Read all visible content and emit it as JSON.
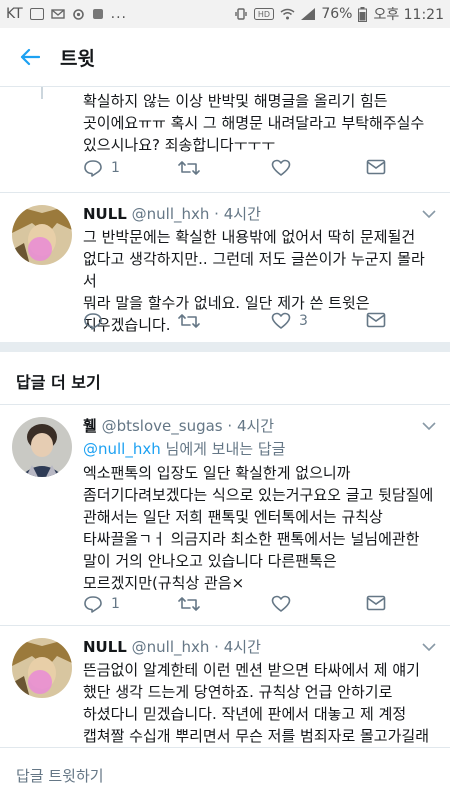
{
  "statusbar": {
    "carrier": "KT",
    "more": "...",
    "battery": "76%",
    "time": "오후 11:21"
  },
  "appbar": {
    "title": "트윗"
  },
  "tweets_top": {
    "text": "확실하지 않는 이상 반박및 해명글을 올리기 힘든\n곳이에요ㅠㅠ 혹시 그 해명문 내려달라고 부탁해주실수\n있으시나요? 죄송합니다ㅜㅜㅜ",
    "reply_count": "1"
  },
  "tweet2": {
    "name": "NULL",
    "handle": "@null_hxh",
    "dot": "·",
    "time": "4시간",
    "text": "그 반박문에는 확실한 내용밖에 없어서 딱히 문제될건\n없다고 생각하지만.. 그런데 저도 글쓴이가 누군지 몰라서\n뭐라 말을 할수가 없네요. 일단 제가 쓴 트윗은\n지우겠습니다.",
    "like_count": "3"
  },
  "more_replies": {
    "title": "답글 더 보기"
  },
  "tweet3": {
    "name": "휄",
    "handle": "@btslove_sugas",
    "dot": "·",
    "time": "4시간",
    "reply_mention": "@null_hxh",
    "reply_suffix": " 님에게 보내는 답글",
    "text": "엑소팬톡의 입장도 일단 확실한게 없으니까\n좀더기다려보겠다는 식으로 있는거구요오 글고 뒷담질에\n관해서는 일단 저희 팬톡및 엔터톡에서는 규칙상\n타싸끌올ㄱㅓ 의금지라 최소한 팬톡에서는 널님에관한\n말이 거의 안나오고 있습니다 다른팬톡은\n모르겠지만(규칙상 관음×",
    "reply_count": "1"
  },
  "tweet4": {
    "name": "NULL",
    "handle": "@null_hxh",
    "dot": "·",
    "time": "4시간",
    "text": "뜬금없이 알계한테 이런 멘션 받으면 타싸에서 제 얘기\n했단 생각 드는게 당연하죠. 규칙상 언급 안하기로\n하셨다니 믿겠습니다. 작년에 판에서 대놓고 제 계정\n캡쳐짤 수십개 뿌리면서 무슨 저를 범죄자로 몰고가길래\n아직도 그러는줄 알았어요ㅋㅋ"
  },
  "reply_input": {
    "placeholder": "답글 트윗하기"
  },
  "colors": {
    "accent": "#1da1f2",
    "muted": "#657786",
    "text": "#14171a",
    "divider": "#e1e8ed"
  }
}
